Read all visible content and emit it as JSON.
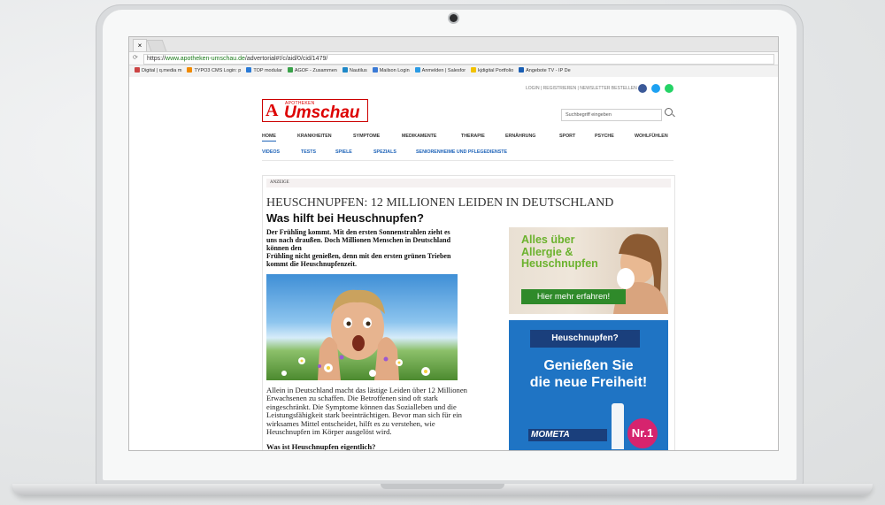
{
  "browser": {
    "tab_close": "×",
    "reload_glyph": "⟳",
    "url_prefix": "https://",
    "url_host": "www.apotheken-umschau.de",
    "url_path": "/advertorial#!/c/aid/0/cid/1479/",
    "bookmarks": [
      {
        "label": "Digital | q.media m",
        "color": "#c44"
      },
      {
        "label": "TYPO3 CMS Login: p",
        "color": "#f08a00"
      },
      {
        "label": "TOP modular",
        "color": "#2a7ad6"
      },
      {
        "label": "AGOF - Zusammen",
        "color": "#3aa24a"
      },
      {
        "label": "Nautilus",
        "color": "#1e88c8"
      },
      {
        "label": "Mailson Login",
        "color": "#3a7ad6"
      },
      {
        "label": "Anmelden | Salesfor",
        "color": "#2b9be4"
      },
      {
        "label": "kjdigital Portfolio",
        "color": "#f2c200"
      },
      {
        "label": "Angebote TV - IP De",
        "color": "#1a5fb4"
      }
    ]
  },
  "site": {
    "top_links": "LOGIN | REGISTRIEREN | NEWSLETTER BESTELLEN",
    "logo_mark": "A",
    "logo_small": "APOTHEKEN",
    "logo_text": "Umschau",
    "search_placeholder": "Suchbegriff eingeben",
    "nav_primary": [
      "HOME",
      "KRANKHEITEN",
      "SYMPTOME",
      "MEDIKAMENTE",
      "THERAPIE",
      "ERNÄHRUNG",
      "SPORT",
      "PSYCHE",
      "WOHLFÜHLEN"
    ],
    "nav_secondary": [
      "VIDEOS",
      "TESTS",
      "SPIELE",
      "SPEZIALS",
      "SENIORENHEIME UND PFLEGEDIENSTE"
    ],
    "social_colors": {
      "facebook": "#3b5998",
      "twitter": "#1da1f2",
      "whatsapp": "#25d366"
    }
  },
  "article": {
    "label": "ANZEIGE",
    "kicker": "HEUSCHNUPFEN: 12 MILLIONEN LEIDEN IN DEUTSCHLAND",
    "headline": "Was hilft bei Heuschnupfen?",
    "lead_lines": [
      "Der Frühling kommt. Mit den ersten Sonnenstrahlen zieht es",
      "uns nach draußen. Doch Millionen Menschen in Deutschland",
      "können den",
      "Frühling nicht genießen, denn mit den ersten grünen Trieben",
      "kommt die Heuschnupfenzeit."
    ],
    "body_lines": [
      "Allein in Deutschland macht das lästige Leiden über 12 Millionen",
      "Erwachsenen zu schaffen. Die Betroffenen sind oft stark",
      "eingeschränkt. Die Symptome können das Sozialleben und die",
      "Leistungsfähigkeit stark beeinträchtigen. Bevor man sich für ein",
      "wirksames Mittel entscheidet, hilft es zu verstehen, wie",
      "Heuschnupfen im Körper ausgelöst wird."
    ],
    "subheading": "Was ist Heuschnupfen eigentlich?"
  },
  "ad_allergy": {
    "title_lines": [
      "Alles über",
      "Allergie &",
      "Heuschnupfen"
    ],
    "cta": "Hier mehr erfahren!"
  },
  "ad_mometa": {
    "tag": "Heuschnupfen?",
    "headline_lines": [
      "Genießen Sie",
      "die neue Freiheit!"
    ],
    "product": "MOMETA",
    "badge": "Nr.1"
  }
}
